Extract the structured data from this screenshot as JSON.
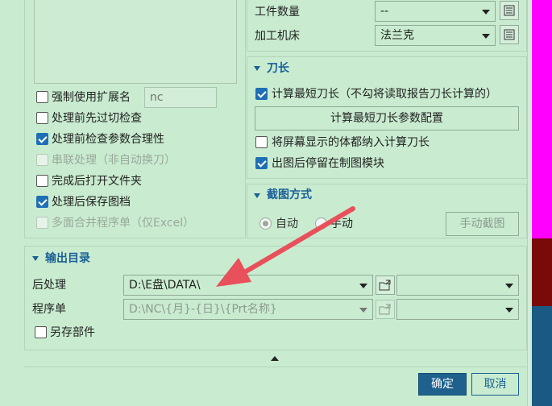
{
  "colors": {
    "bg": "#c9ecd0",
    "accent": "#1b5f96",
    "primary_button": "#1f618d",
    "arrow": "#e8505b",
    "side_strip": [
      "#ff00ff",
      "#7a0a0a",
      "#1a5a82"
    ]
  },
  "left_options": {
    "force_ext_label": "强制使用扩展名",
    "force_ext_value": "nc",
    "items": [
      {
        "label": "处理前先过切检查",
        "checked": false,
        "disabled": false
      },
      {
        "label": "处理前检查参数合理性",
        "checked": true,
        "disabled": false
      },
      {
        "label": "串联处理（非自动换刀）",
        "checked": false,
        "disabled": true
      },
      {
        "label": "完成后打开文件夹",
        "checked": false,
        "disabled": false
      },
      {
        "label": "处理后保存图档",
        "checked": true,
        "disabled": false
      },
      {
        "label": "多面合并程序单（仅Excel）",
        "checked": false,
        "disabled": true
      }
    ]
  },
  "top_right": {
    "workpiece_label": "工件数量",
    "workpiece_value": "--",
    "machine_label": "加工机床",
    "machine_value": "法兰克"
  },
  "tool_length": {
    "title": "刀长",
    "calc_shortest_label": "计算最短刀长（不勾将读取报告刀长计算的）",
    "calc_shortest_checked": true,
    "config_button": "计算最短刀长参数配置",
    "include_body_label": "将屏幕显示的体都纳入计算刀长",
    "include_body_checked": false,
    "stay_label": "出图后停留在制图模块",
    "stay_checked": true
  },
  "screenshot_mode": {
    "title": "截图方式",
    "auto_label": "自动",
    "manual_label": "手动",
    "manual_button": "手动截图"
  },
  "output": {
    "title": "输出目录",
    "postprocess_label": "后处理",
    "postprocess_value": "D:\\E盘\\DATA\\",
    "program_label": "程序单",
    "program_value": "D:\\NC\\{月}-{日}\\{Prt名称}",
    "save_part_label": "另存部件"
  },
  "footer": {
    "ok": "确定",
    "cancel": "取消"
  }
}
